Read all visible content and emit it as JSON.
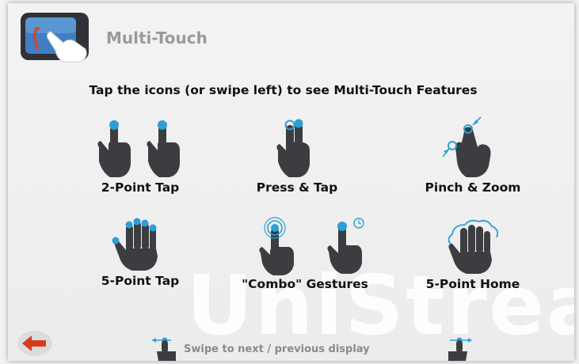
{
  "header": {
    "title": "Multi-Touch"
  },
  "instruction": "Tap the icons (or swipe left) to see Multi-Touch Features",
  "features": [
    {
      "label": "2-Point Tap"
    },
    {
      "label": "Press & Tap"
    },
    {
      "label": "Pinch & Zoom"
    },
    {
      "label": "5-Point Tap"
    },
    {
      "label": "\"Combo\" Gestures"
    },
    {
      "label": "5-Point Home"
    }
  ],
  "footer": {
    "hint": "Swipe to next / previous display"
  },
  "watermark": "UniStream",
  "colors": {
    "accent": "#2b9fd8",
    "hand": "#3b3d40",
    "back_arrow": "#d83a1c"
  },
  "icons": {
    "app": "multi-touch-app-icon",
    "back": "back-arrow-icon"
  }
}
